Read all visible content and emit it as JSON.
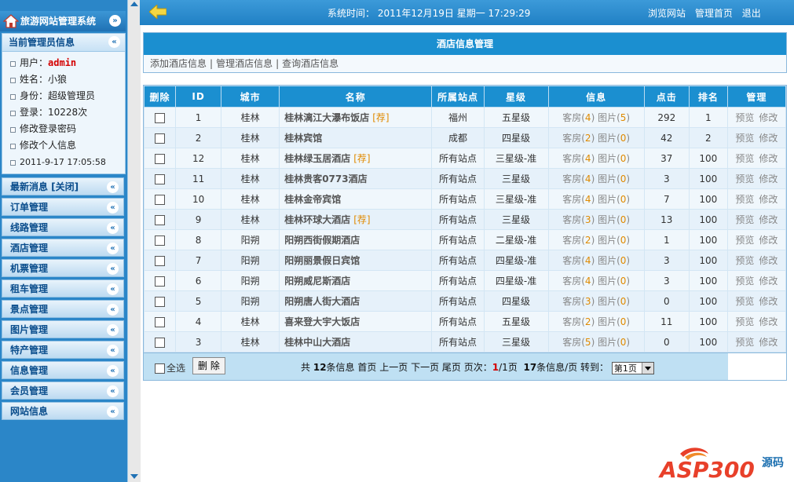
{
  "sidebar": {
    "system_title": "旅游网站管理系统",
    "admin_panel": {
      "title": "当前管理员信息",
      "user_label": "用户：",
      "user_value": "admin",
      "name": "姓名：小狼",
      "role": "身份：超级管理员",
      "logins": "登录：10228次",
      "change_password": "修改登录密码",
      "edit_profile": "修改个人信息",
      "timestamp": "2011-9-17 17:05:58"
    },
    "menu": [
      "最新消息 [关闭]",
      "订单管理",
      "线路管理",
      "酒店管理",
      "机票管理",
      "租车管理",
      "景点管理",
      "图片管理",
      "特产管理",
      "信息管理",
      "会员管理",
      "网站信息"
    ],
    "collapse_glyph": "«"
  },
  "topbar": {
    "system_time": "系统时间： 2011年12月19日 星期一 17:29:29",
    "links": [
      "浏览网站",
      "管理首页",
      "退出"
    ]
  },
  "page": {
    "title": "酒店信息管理",
    "sub_links": [
      "添加酒店信息",
      "管理酒店信息",
      "查询酒店信息"
    ],
    "separator": "|"
  },
  "table": {
    "headers": [
      "删除",
      "ID",
      "城市",
      "名称",
      "所属站点",
      "星级",
      "信息",
      "点击",
      "排名",
      "管理"
    ],
    "rows": [
      {
        "id": "1",
        "city": "桂林",
        "name": "桂林漓江大瀑布饭店",
        "rec": "[荐]",
        "site": "福州",
        "star": "五星级",
        "room": "4",
        "pic": "5",
        "clicks": "292",
        "rank": "1"
      },
      {
        "id": "2",
        "city": "桂林",
        "name": "桂林宾馆",
        "rec": "",
        "site": "成都",
        "star": "四星级",
        "room": "2",
        "pic": "0",
        "clicks": "42",
        "rank": "2"
      },
      {
        "id": "12",
        "city": "桂林",
        "name": "桂林绿玉居酒店",
        "rec": "[荐]",
        "site": "所有站点",
        "star": "三星级-准",
        "room": "4",
        "pic": "0",
        "clicks": "37",
        "rank": "100"
      },
      {
        "id": "11",
        "city": "桂林",
        "name": "桂林贵客0773酒店",
        "rec": "",
        "site": "所有站点",
        "star": "三星级",
        "room": "4",
        "pic": "0",
        "clicks": "3",
        "rank": "100"
      },
      {
        "id": "10",
        "city": "桂林",
        "name": "桂林金帝宾馆",
        "rec": "",
        "site": "所有站点",
        "star": "三星级-准",
        "room": "4",
        "pic": "0",
        "clicks": "7",
        "rank": "100"
      },
      {
        "id": "9",
        "city": "桂林",
        "name": "桂林环球大酒店",
        "rec": "[荐]",
        "site": "所有站点",
        "star": "三星级",
        "room": "3",
        "pic": "0",
        "clicks": "13",
        "rank": "100"
      },
      {
        "id": "8",
        "city": "阳朔",
        "name": "阳朔西街假期酒店",
        "rec": "",
        "site": "所有站点",
        "star": "二星级-准",
        "room": "2",
        "pic": "0",
        "clicks": "1",
        "rank": "100"
      },
      {
        "id": "7",
        "city": "阳朔",
        "name": "阳朔丽景假日宾馆",
        "rec": "",
        "site": "所有站点",
        "star": "四星级-准",
        "room": "4",
        "pic": "0",
        "clicks": "3",
        "rank": "100"
      },
      {
        "id": "6",
        "city": "阳朔",
        "name": "阳朔威尼斯酒店",
        "rec": "",
        "site": "所有站点",
        "star": "四星级-准",
        "room": "4",
        "pic": "0",
        "clicks": "3",
        "rank": "100"
      },
      {
        "id": "5",
        "city": "阳朔",
        "name": "阳朔唐人街大酒店",
        "rec": "",
        "site": "所有站点",
        "star": "四星级",
        "room": "3",
        "pic": "0",
        "clicks": "0",
        "rank": "100"
      },
      {
        "id": "4",
        "city": "桂林",
        "name": "喜来登大宇大饭店",
        "rec": "",
        "site": "所有站点",
        "star": "五星级",
        "room": "2",
        "pic": "0",
        "clicks": "11",
        "rank": "100"
      },
      {
        "id": "3",
        "city": "桂林",
        "name": "桂林中山大酒店",
        "rec": "",
        "site": "所有站点",
        "star": "三星级",
        "room": "5",
        "pic": "0",
        "clicks": "0",
        "rank": "100"
      }
    ],
    "room_label": "客房",
    "pic_label": "图片",
    "preview_label": "预览",
    "edit_label": "修改"
  },
  "footer": {
    "select_all": "全选",
    "delete_button": "删 除",
    "pager_prefix": "共",
    "total": "12",
    "pager_total_suffix": "条信息",
    "first": "首页",
    "prev": "上一页",
    "next": "下一页",
    "last": "尾页",
    "page_label": "页次：",
    "current_page": "1",
    "total_pages": "/1页",
    "per_page": "17",
    "per_page_suffix": "条信息/页",
    "goto_label": "转到：",
    "page_select_value": "第1页"
  },
  "watermark": {
    "brand": "ASP300",
    "suffix": "源码"
  },
  "colors": {
    "header_blue": "#1b8fd0",
    "sidebar_blue": "#2b86c8",
    "accent_orange": "#e08a00",
    "admin_red": "#d40000"
  }
}
